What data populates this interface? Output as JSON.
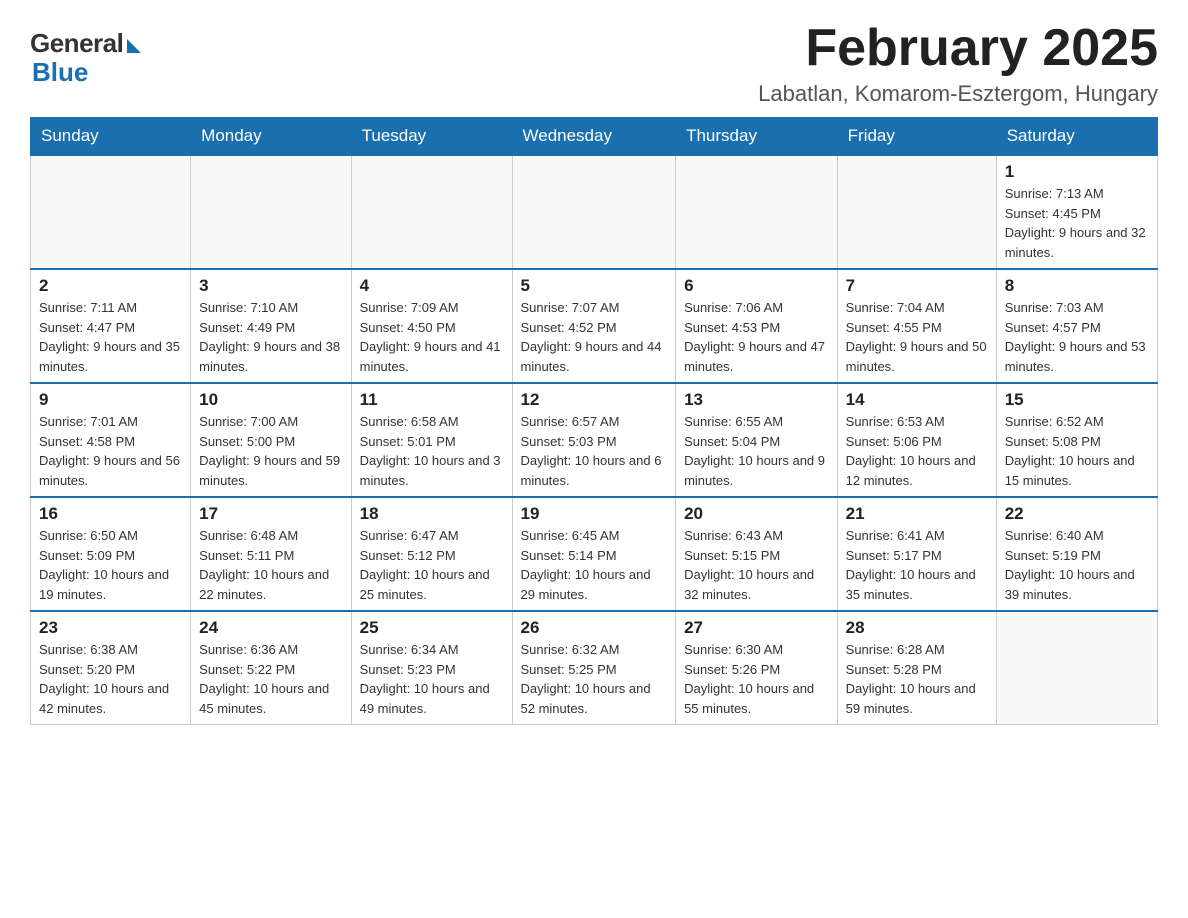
{
  "logo": {
    "general": "General",
    "blue": "Blue"
  },
  "title": "February 2025",
  "location": "Labatlan, Komarom-Esztergom, Hungary",
  "weekdays": [
    "Sunday",
    "Monday",
    "Tuesday",
    "Wednesday",
    "Thursday",
    "Friday",
    "Saturday"
  ],
  "weeks": [
    [
      {
        "day": "",
        "info": ""
      },
      {
        "day": "",
        "info": ""
      },
      {
        "day": "",
        "info": ""
      },
      {
        "day": "",
        "info": ""
      },
      {
        "day": "",
        "info": ""
      },
      {
        "day": "",
        "info": ""
      },
      {
        "day": "1",
        "info": "Sunrise: 7:13 AM\nSunset: 4:45 PM\nDaylight: 9 hours and 32 minutes."
      }
    ],
    [
      {
        "day": "2",
        "info": "Sunrise: 7:11 AM\nSunset: 4:47 PM\nDaylight: 9 hours and 35 minutes."
      },
      {
        "day": "3",
        "info": "Sunrise: 7:10 AM\nSunset: 4:49 PM\nDaylight: 9 hours and 38 minutes."
      },
      {
        "day": "4",
        "info": "Sunrise: 7:09 AM\nSunset: 4:50 PM\nDaylight: 9 hours and 41 minutes."
      },
      {
        "day": "5",
        "info": "Sunrise: 7:07 AM\nSunset: 4:52 PM\nDaylight: 9 hours and 44 minutes."
      },
      {
        "day": "6",
        "info": "Sunrise: 7:06 AM\nSunset: 4:53 PM\nDaylight: 9 hours and 47 minutes."
      },
      {
        "day": "7",
        "info": "Sunrise: 7:04 AM\nSunset: 4:55 PM\nDaylight: 9 hours and 50 minutes."
      },
      {
        "day": "8",
        "info": "Sunrise: 7:03 AM\nSunset: 4:57 PM\nDaylight: 9 hours and 53 minutes."
      }
    ],
    [
      {
        "day": "9",
        "info": "Sunrise: 7:01 AM\nSunset: 4:58 PM\nDaylight: 9 hours and 56 minutes."
      },
      {
        "day": "10",
        "info": "Sunrise: 7:00 AM\nSunset: 5:00 PM\nDaylight: 9 hours and 59 minutes."
      },
      {
        "day": "11",
        "info": "Sunrise: 6:58 AM\nSunset: 5:01 PM\nDaylight: 10 hours and 3 minutes."
      },
      {
        "day": "12",
        "info": "Sunrise: 6:57 AM\nSunset: 5:03 PM\nDaylight: 10 hours and 6 minutes."
      },
      {
        "day": "13",
        "info": "Sunrise: 6:55 AM\nSunset: 5:04 PM\nDaylight: 10 hours and 9 minutes."
      },
      {
        "day": "14",
        "info": "Sunrise: 6:53 AM\nSunset: 5:06 PM\nDaylight: 10 hours and 12 minutes."
      },
      {
        "day": "15",
        "info": "Sunrise: 6:52 AM\nSunset: 5:08 PM\nDaylight: 10 hours and 15 minutes."
      }
    ],
    [
      {
        "day": "16",
        "info": "Sunrise: 6:50 AM\nSunset: 5:09 PM\nDaylight: 10 hours and 19 minutes."
      },
      {
        "day": "17",
        "info": "Sunrise: 6:48 AM\nSunset: 5:11 PM\nDaylight: 10 hours and 22 minutes."
      },
      {
        "day": "18",
        "info": "Sunrise: 6:47 AM\nSunset: 5:12 PM\nDaylight: 10 hours and 25 minutes."
      },
      {
        "day": "19",
        "info": "Sunrise: 6:45 AM\nSunset: 5:14 PM\nDaylight: 10 hours and 29 minutes."
      },
      {
        "day": "20",
        "info": "Sunrise: 6:43 AM\nSunset: 5:15 PM\nDaylight: 10 hours and 32 minutes."
      },
      {
        "day": "21",
        "info": "Sunrise: 6:41 AM\nSunset: 5:17 PM\nDaylight: 10 hours and 35 minutes."
      },
      {
        "day": "22",
        "info": "Sunrise: 6:40 AM\nSunset: 5:19 PM\nDaylight: 10 hours and 39 minutes."
      }
    ],
    [
      {
        "day": "23",
        "info": "Sunrise: 6:38 AM\nSunset: 5:20 PM\nDaylight: 10 hours and 42 minutes."
      },
      {
        "day": "24",
        "info": "Sunrise: 6:36 AM\nSunset: 5:22 PM\nDaylight: 10 hours and 45 minutes."
      },
      {
        "day": "25",
        "info": "Sunrise: 6:34 AM\nSunset: 5:23 PM\nDaylight: 10 hours and 49 minutes."
      },
      {
        "day": "26",
        "info": "Sunrise: 6:32 AM\nSunset: 5:25 PM\nDaylight: 10 hours and 52 minutes."
      },
      {
        "day": "27",
        "info": "Sunrise: 6:30 AM\nSunset: 5:26 PM\nDaylight: 10 hours and 55 minutes."
      },
      {
        "day": "28",
        "info": "Sunrise: 6:28 AM\nSunset: 5:28 PM\nDaylight: 10 hours and 59 minutes."
      },
      {
        "day": "",
        "info": ""
      }
    ]
  ]
}
